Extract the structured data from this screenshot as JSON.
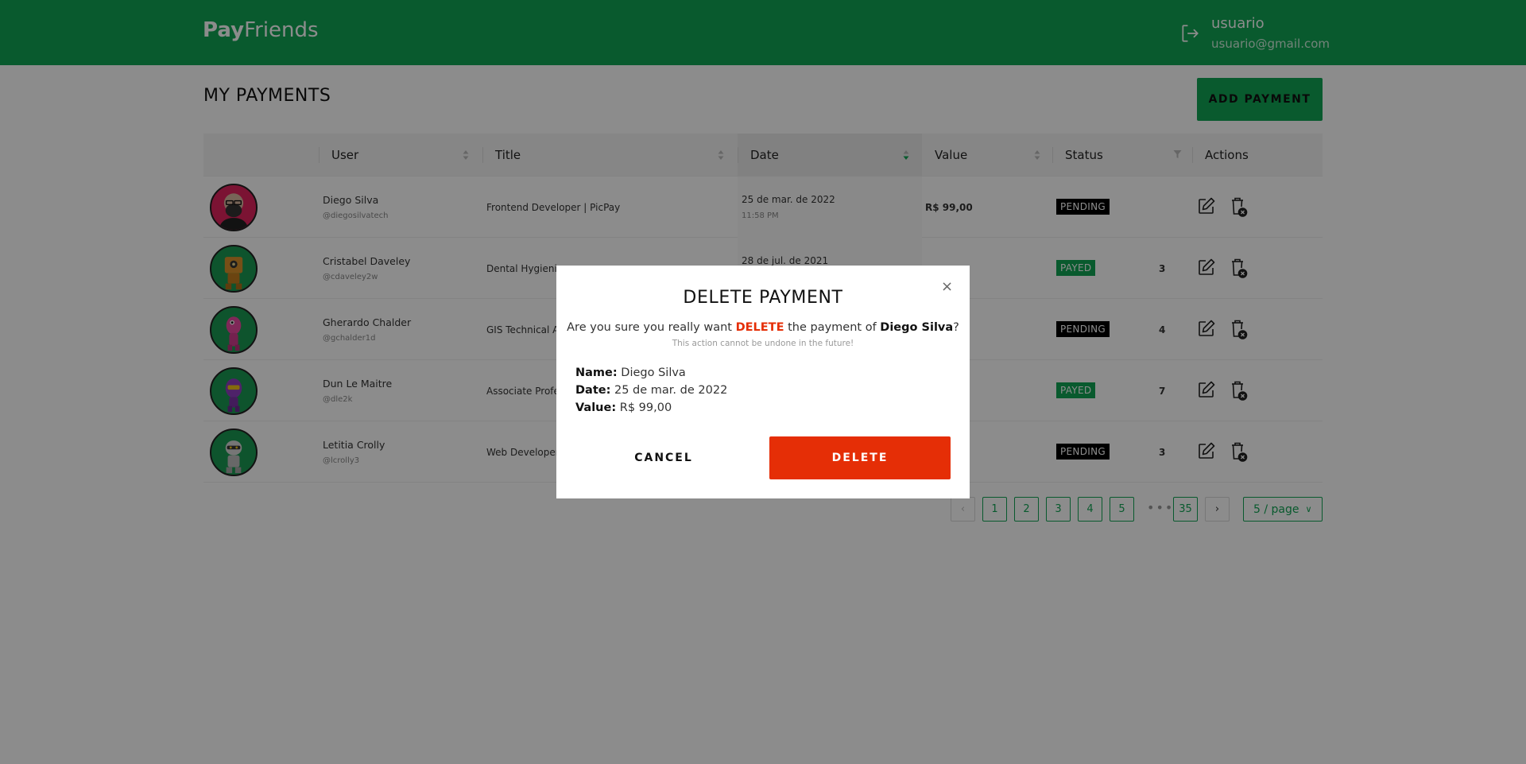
{
  "colors": {
    "brand": "#12a454",
    "danger": "#e52e06",
    "pending": "#000000",
    "payed": "#12a454"
  },
  "header": {
    "logo_bold": "Pay",
    "logo_light": "Friends",
    "logout_icon": "logout-icon",
    "user_name": "usuario",
    "user_email": "usuario@gmail.com"
  },
  "page": {
    "title": "MY PAYMENTS",
    "add_button": "ADD PAYMENT"
  },
  "table": {
    "columns": {
      "user": "User",
      "title": "Title",
      "date": "Date",
      "value": "Value",
      "status": "Status",
      "actions": "Actions"
    },
    "rows": [
      {
        "name": "Diego Silva",
        "handle": "@diegosilvatech",
        "title": "Frontend Developer | PicPay",
        "date": "25 de mar. de 2022",
        "time": "11:58 PM",
        "value": "R$ 99,00",
        "status": "PENDING"
      },
      {
        "name": "Cristabel Daveley",
        "handle": "@cdaveley2w",
        "title": "Dental Hygienis",
        "date": "28 de jul. de 2021",
        "time": "",
        "value": "3",
        "status": "PAYED"
      },
      {
        "name": "Gherardo Chalder",
        "handle": "@gchalder1d",
        "title": "GIS Technical A",
        "date": "",
        "time": "",
        "value": "4",
        "status": "PENDING"
      },
      {
        "name": "Dun Le Maitre",
        "handle": "@dle2k",
        "title": "Associate Profes",
        "date": "",
        "time": "",
        "value": "7",
        "status": "PAYED"
      },
      {
        "name": "Letitia Crolly",
        "handle": "@lcrolly3",
        "title": "Web Developer",
        "date": "",
        "time": "",
        "value": "3",
        "status": "PENDING"
      }
    ]
  },
  "pagination": {
    "pages": [
      "1",
      "2",
      "3",
      "4",
      "5"
    ],
    "ellipsis": "•••",
    "last": "35",
    "prev": "‹",
    "next": "›",
    "page_size": "5 / page"
  },
  "modal": {
    "close": "×",
    "title": "DELETE PAYMENT",
    "question_pre": "Are you sure you really want ",
    "question_danger": "DELETE",
    "question_mid": " the payment of ",
    "question_name": "Diego Silva",
    "question_post": "?",
    "warning": "This action cannot be undone in the future!",
    "name_label": "Name:",
    "name_value": "Diego Silva",
    "date_label": "Date:",
    "date_value": "25 de mar. de 2022",
    "value_label": "Value:",
    "value_value": "R$ 99,00",
    "cancel": "CANCEL",
    "delete": "DELETE"
  }
}
